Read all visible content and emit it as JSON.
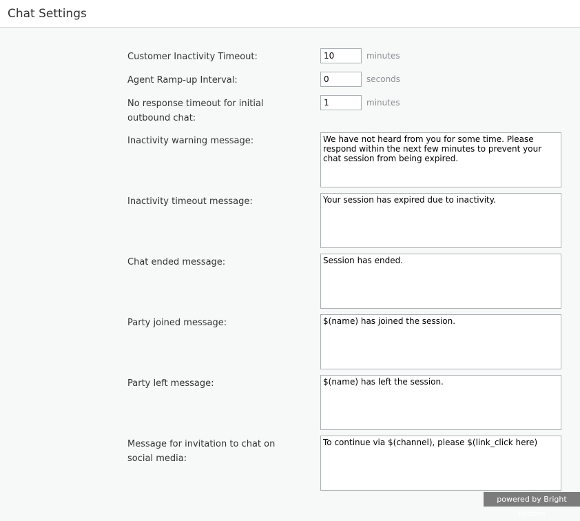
{
  "header": {
    "title": "Chat Settings"
  },
  "settings": {
    "customer_inactivity": {
      "label": "Customer Inactivity Timeout:",
      "value": "10",
      "unit": "minutes"
    },
    "agent_rampup": {
      "label": "Agent Ramp-up Interval:",
      "value": "0",
      "unit": "seconds"
    },
    "no_response": {
      "label": "No response timeout for initial outbound chat:",
      "value": "1",
      "unit": "minutes"
    }
  },
  "messages": {
    "inactivity_warning": {
      "label": "Inactivity warning message:",
      "value": "We have not heard from you for some time. Please respond within the next few minutes to prevent your chat session from being expired."
    },
    "inactivity_timeout": {
      "label": "Inactivity timeout message:",
      "value": "Your session has expired due to inactivity."
    },
    "chat_ended": {
      "label": "Chat ended message:",
      "value": "Session has ended."
    },
    "party_joined": {
      "label": "Party joined message:",
      "value": "$(name) has joined the session."
    },
    "party_left": {
      "label": "Party left message:",
      "value": "$(name) has left the session."
    },
    "social_invitation": {
      "label": "Message for invitation to chat on social media:",
      "value": "To continue via $(channel), please $(link_click here)"
    }
  },
  "footer": {
    "powered_by": "powered by Bright Pattern"
  }
}
